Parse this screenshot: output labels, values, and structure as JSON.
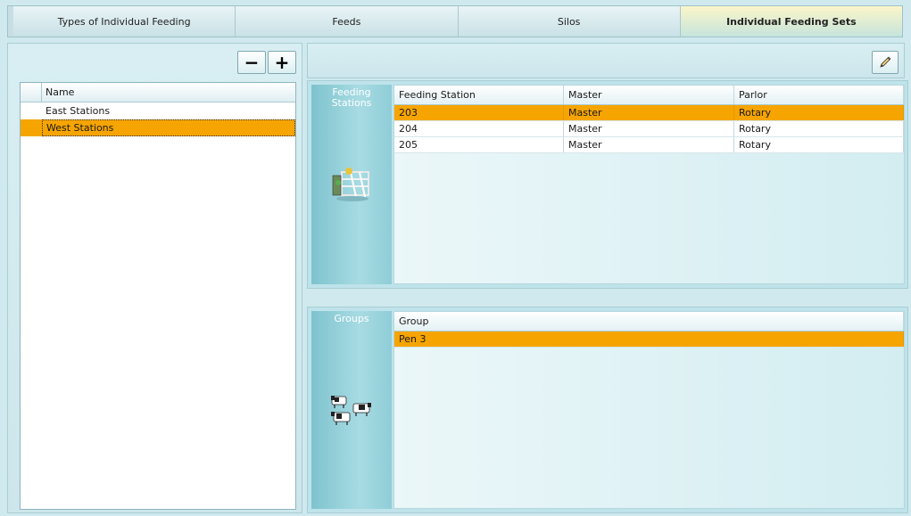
{
  "tabs": [
    {
      "label": "Types of Individual Feeding",
      "active": false
    },
    {
      "label": "Feeds",
      "active": false
    },
    {
      "label": "Silos",
      "active": false
    },
    {
      "label": "Individual Feeding Sets",
      "active": true
    }
  ],
  "left_panel": {
    "remove_label": "−",
    "add_label": "+",
    "column_header": "Name",
    "items": [
      {
        "label": "East Stations",
        "selected": false
      },
      {
        "label": "West Stations",
        "selected": true
      }
    ]
  },
  "feeding_stations": {
    "side_label_line1": "Feeding",
    "side_label_line2": "Stations",
    "icon": "feeding-station-icon",
    "columns": [
      "Feeding Station",
      "Master",
      "Parlor"
    ],
    "rows": [
      {
        "station": "203",
        "master": "Master",
        "parlor": "Rotary",
        "selected": true
      },
      {
        "station": "204",
        "master": "Master",
        "parlor": "Rotary",
        "selected": false
      },
      {
        "station": "205",
        "master": "Master",
        "parlor": "Rotary",
        "selected": false
      }
    ]
  },
  "groups": {
    "side_label": "Groups",
    "icon": "cows-icon",
    "columns": [
      "Group"
    ],
    "rows": [
      {
        "group": "Pen 3",
        "selected": true
      }
    ]
  },
  "toolbar": {
    "edit_icon": "pencil-icon"
  },
  "colors": {
    "selected_row": "#f6a400",
    "panel_bg": "#cfe9ee",
    "side_label_bg": "#7ec3ce"
  }
}
